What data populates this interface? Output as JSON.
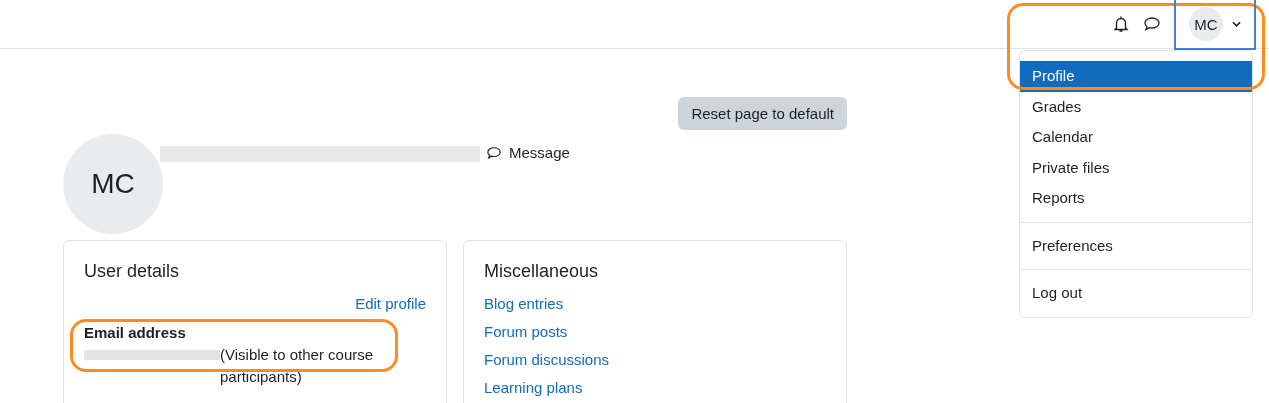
{
  "navbar": {
    "avatar_initials": "MC"
  },
  "user_menu": {
    "sections": [
      [
        {
          "label": "Profile",
          "selected": true
        },
        {
          "label": "Grades",
          "selected": false
        },
        {
          "label": "Calendar",
          "selected": false
        },
        {
          "label": "Private files",
          "selected": false
        },
        {
          "label": "Reports",
          "selected": false
        }
      ],
      [
        {
          "label": "Preferences",
          "selected": false
        }
      ],
      [
        {
          "label": "Log out",
          "selected": false
        }
      ]
    ]
  },
  "header": {
    "reset_button": "Reset page to default",
    "avatar_initials": "MC",
    "message_link": "Message"
  },
  "user_details": {
    "title": "User details",
    "edit_link": "Edit profile",
    "fields": [
      {
        "label": "Email address",
        "note": "(Visible to other course participants)"
      }
    ]
  },
  "miscellaneous": {
    "title": "Miscellaneous",
    "links": [
      "Blog entries",
      "Forum posts",
      "Forum discussions",
      "Learning plans"
    ]
  }
}
